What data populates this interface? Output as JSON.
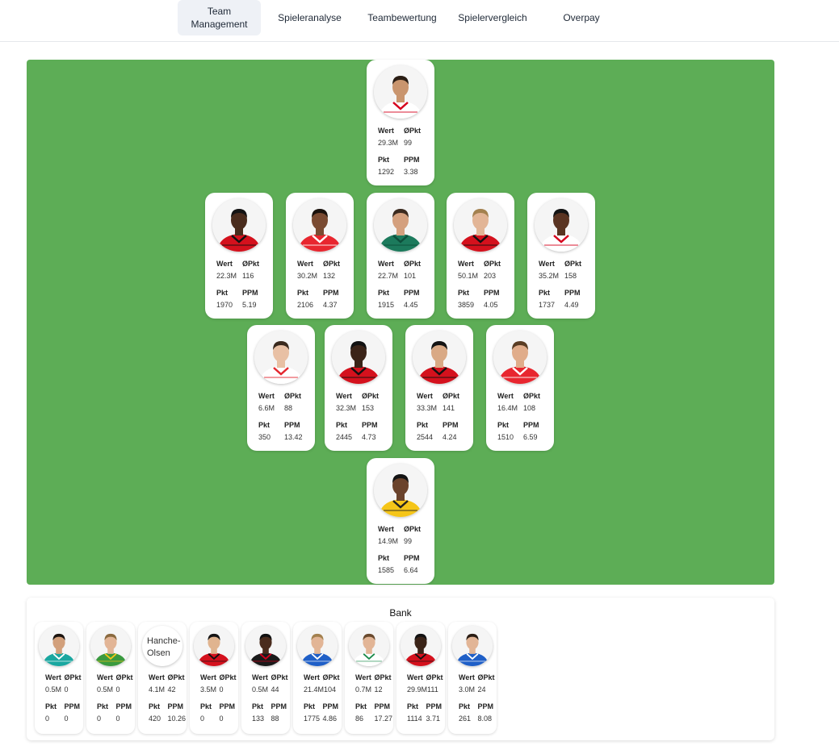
{
  "nav": {
    "tabs": [
      {
        "label": "Team\nManagement",
        "active": true
      },
      {
        "label": "Spieleranalyse",
        "active": false
      },
      {
        "label": "Teambewertung",
        "active": false
      },
      {
        "label": "Spielervergleich",
        "active": false
      },
      {
        "label": "Overpay",
        "active": false
      }
    ]
  },
  "stat_labels": {
    "wert": "Wert",
    "opkt": "ØPkt",
    "pkt": "Pkt",
    "ppm": "PPM"
  },
  "formation": [
    [
      {
        "wert": "29.3M",
        "opkt": "99",
        "pkt": "1292",
        "ppm": "3.38",
        "kit": "#ffffff",
        "trim": "#d6001c",
        "skin": "#c9956e",
        "hair": "#2a1d14"
      }
    ],
    [
      {
        "wert": "22.3M",
        "opkt": "116",
        "pkt": "1970",
        "ppm": "5.19",
        "kit": "#d4111d",
        "trim": "#111111",
        "skin": "#4a2c1d",
        "hair": "#141414"
      },
      {
        "wert": "30.2M",
        "opkt": "132",
        "pkt": "2106",
        "ppm": "4.37",
        "kit": "#e8262f",
        "trim": "#ffffff",
        "skin": "#7a4b32",
        "hair": "#1a120d"
      },
      {
        "wert": "22.7M",
        "opkt": "101",
        "pkt": "1915",
        "ppm": "4.45",
        "kit": "#1c7a5c",
        "trim": "#0e4f3b",
        "skin": "#d4a07e",
        "hair": "#3b2a1f"
      },
      {
        "wert": "50.1M",
        "opkt": "203",
        "pkt": "3859",
        "ppm": "4.05",
        "kit": "#d4111d",
        "trim": "#111111",
        "skin": "#e2b596",
        "hair": "#a3814f"
      },
      {
        "wert": "35.2M",
        "opkt": "158",
        "pkt": "1737",
        "ppm": "4.49",
        "kit": "#ffffff",
        "trim": "#d6001c",
        "skin": "#5a3422",
        "hair": "#141414"
      }
    ],
    [
      {
        "wert": "6.6M",
        "opkt": "88",
        "pkt": "350",
        "ppm": "13.42",
        "kit": "#ffffff",
        "trim": "#e4262e",
        "skin": "#e8c0a4",
        "hair": "#3a2a1e"
      },
      {
        "wert": "32.3M",
        "opkt": "153",
        "pkt": "2445",
        "ppm": "4.73",
        "kit": "#d4111d",
        "trim": "#111111",
        "skin": "#3b2418",
        "hair": "#121212"
      },
      {
        "wert": "33.3M",
        "opkt": "141",
        "pkt": "2544",
        "ppm": "4.24",
        "kit": "#d4111d",
        "trim": "#111111",
        "skin": "#d9a985",
        "hair": "#141414"
      },
      {
        "wert": "16.4M",
        "opkt": "108",
        "pkt": "1510",
        "ppm": "6.59",
        "kit": "#e8262f",
        "trim": "#ffffff",
        "skin": "#e0ac8a",
        "hair": "#5a3d24"
      }
    ],
    [
      {
        "wert": "14.9M",
        "opkt": "99",
        "pkt": "1585",
        "ppm": "6.64",
        "kit": "#f5c518",
        "trim": "#222222",
        "skin": "#6b432c",
        "hair": "#141414"
      }
    ]
  ],
  "bank": {
    "title": "Bank",
    "players": [
      {
        "wert": "0.5M",
        "opkt": "0",
        "pkt": "0",
        "ppm": "0",
        "kit": "#1aa7a0",
        "trim": "#ffffff",
        "skin": "#d2a07c",
        "hair": "#1c1410"
      },
      {
        "wert": "0.5M",
        "opkt": "0",
        "pkt": "0",
        "ppm": "0",
        "kit": "#3a9a3f",
        "trim": "#f5c518",
        "skin": "#e2b596",
        "hair": "#8a6a3f"
      },
      {
        "wert": "4.1M",
        "opkt": "42",
        "pkt": "420",
        "ppm": "10.26",
        "broken": true,
        "alt": "Hanche-Olsen"
      },
      {
        "wert": "3.5M",
        "opkt": "0",
        "pkt": "0",
        "ppm": "0",
        "kit": "#d4111d",
        "trim": "#111111",
        "skin": "#e0b48f",
        "hair": "#151515"
      },
      {
        "wert": "0.5M",
        "opkt": "44",
        "pkt": "133",
        "ppm": "88",
        "kit": "#1a1a1a",
        "trim": "#d6001c",
        "skin": "#4a2c1d",
        "hair": "#111111"
      },
      {
        "wert": "21.4M",
        "opkt": "104",
        "pkt": "1775",
        "ppm": "4.86",
        "kit": "#1f5fc7",
        "trim": "#ffffff",
        "skin": "#e2b596",
        "hair": "#a3814f"
      },
      {
        "wert": "0.7M",
        "opkt": "12",
        "pkt": "86",
        "ppm": "17.27",
        "kit": "#ffffff",
        "trim": "#1a8a4a",
        "skin": "#e2b596",
        "hair": "#6a4a2e"
      },
      {
        "wert": "29.9M",
        "opkt": "111",
        "pkt": "1114",
        "ppm": "3.71",
        "kit": "#d4111d",
        "trim": "#111111",
        "skin": "#3b2418",
        "hair": "#121212"
      },
      {
        "wert": "3.0M",
        "opkt": "24",
        "pkt": "261",
        "ppm": "8.08",
        "kit": "#1f5fc7",
        "trim": "#ffffff",
        "skin": "#e2b596",
        "hair": "#2a1d14"
      }
    ]
  }
}
